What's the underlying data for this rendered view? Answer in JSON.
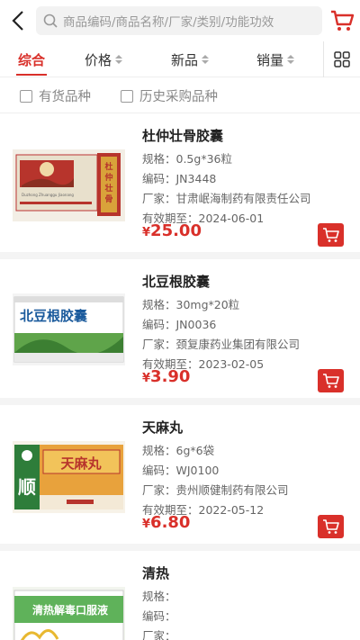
{
  "search": {
    "placeholder": "商品编码/商品名称/厂家/类别/功能功效"
  },
  "sort": {
    "tabs": [
      {
        "label": "综合"
      },
      {
        "label": "价格"
      },
      {
        "label": "新品"
      },
      {
        "label": "销量"
      }
    ]
  },
  "filters": [
    {
      "label": "有货品种"
    },
    {
      "label": "历史采购品种"
    }
  ],
  "products": [
    {
      "name": "杜仲壮骨胶囊",
      "spec": "规格：0.5g*36粒",
      "code": "编码：JN3448",
      "maker": "厂家：甘肃岷海制药有限责任公司",
      "expiry": "有效期至：2024-06-01",
      "price": "25.00",
      "box_text": "杜仲壮骨胶囊",
      "box_sub": "Duzhong Zhuanggu Jiaonang"
    },
    {
      "name": "北豆根胶囊",
      "spec": "规格：30mg*20粒",
      "code": "编码：JN0036",
      "maker": "厂家：颈复康药业集团有限公司",
      "expiry": "有效期至：2023-02-05",
      "price": "3.90",
      "box_text": "北豆根胶囊"
    },
    {
      "name": "天麻丸",
      "spec": "规格：6g*6袋",
      "code": "编码：WJ0100",
      "maker": "厂家：贵州顺健制药有限公司",
      "expiry": "有效期至：2022-05-12",
      "price": "6.80",
      "box_text": "天麻丸",
      "box_side": "顺"
    },
    {
      "name": "清热",
      "spec": "规格：",
      "code": "编码：",
      "maker": "厂家：",
      "box_text": "清热解毒口服液"
    }
  ],
  "currency": "¥",
  "colors": {
    "accent": "#d9302a"
  }
}
